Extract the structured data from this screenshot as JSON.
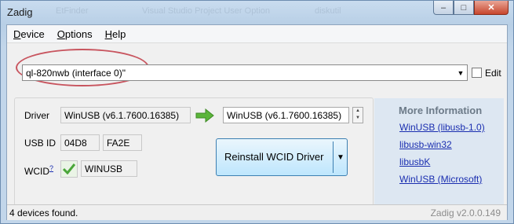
{
  "window": {
    "title": "Zadig",
    "background_hints": [
      "EtFinder",
      "Visual Studio Project User Option",
      "diskutil"
    ]
  },
  "menu": [
    {
      "prefix": "D",
      "rest": "evice"
    },
    {
      "prefix": "O",
      "rest": "ptions"
    },
    {
      "prefix": "H",
      "rest": "elp"
    }
  ],
  "device": {
    "selected": "ql-820nwb (interface 0)\"",
    "edit_label": "Edit"
  },
  "driver": {
    "label": "Driver",
    "current": "WinUSB (v6.1.7600.16385)",
    "target": "WinUSB (v6.1.7600.16385)"
  },
  "usbid": {
    "label": "USB ID",
    "vid": "04D8",
    "pid": "FA2E"
  },
  "wcid": {
    "label": "WCID",
    "sup": "?",
    "value": "WINUSB"
  },
  "reinstall": {
    "label": "Reinstall WCID Driver"
  },
  "info": {
    "title": "More Information",
    "links": [
      "WinUSB (libusb-1.0)",
      "libusb-win32",
      "libusbK",
      "WinUSB (Microsoft)"
    ]
  },
  "status": {
    "left": "4 devices found.",
    "right": "Zadig v2.0.0.149"
  },
  "colors": {
    "accent": "#3c7fb1",
    "link": "#1a2eb0",
    "highlight_ellipse": "#c8555f",
    "arrow": "#5bb53a"
  }
}
